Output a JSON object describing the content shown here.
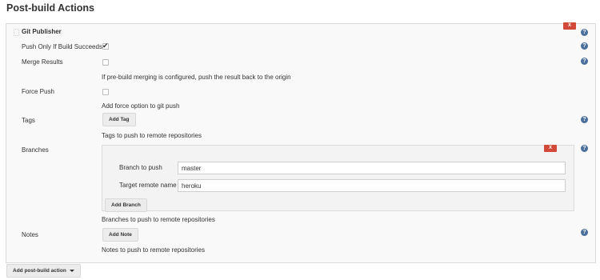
{
  "section_title": "Post-build Actions",
  "publisher": {
    "title": "Git Publisher",
    "delete_label": "X",
    "help_glyph": "?",
    "push_only_if_success": {
      "label": "Push Only If Build Succeeds",
      "checked": true
    },
    "merge_results": {
      "label": "Merge Results",
      "checked": false,
      "description": "If pre-build merging is configured, push the result back to the origin"
    },
    "force_push": {
      "label": "Force Push",
      "checked": false,
      "description": "Add force option to git push"
    },
    "tags": {
      "label": "Tags",
      "add_button": "Add Tag",
      "description": "Tags to push to remote repositories"
    },
    "branches": {
      "label": "Branches",
      "delete_label": "X",
      "branch_to_push": {
        "label": "Branch to push",
        "value": "master"
      },
      "target_remote_name": {
        "label": "Target remote name",
        "value": "heroku"
      },
      "add_button": "Add Branch",
      "description": "Branches to push to remote repositories"
    },
    "notes": {
      "label": "Notes",
      "add_button": "Add Note",
      "description": "Notes to push to remote repositories"
    }
  },
  "add_post_build_action": "Add post-build action",
  "icons": {
    "help": "help-icon",
    "delete": "close-icon",
    "dropdown": "caret-down-icon",
    "check": "check-icon"
  },
  "colors": {
    "delete_button": "#d24939",
    "help_icon": "#4a6f9d"
  }
}
